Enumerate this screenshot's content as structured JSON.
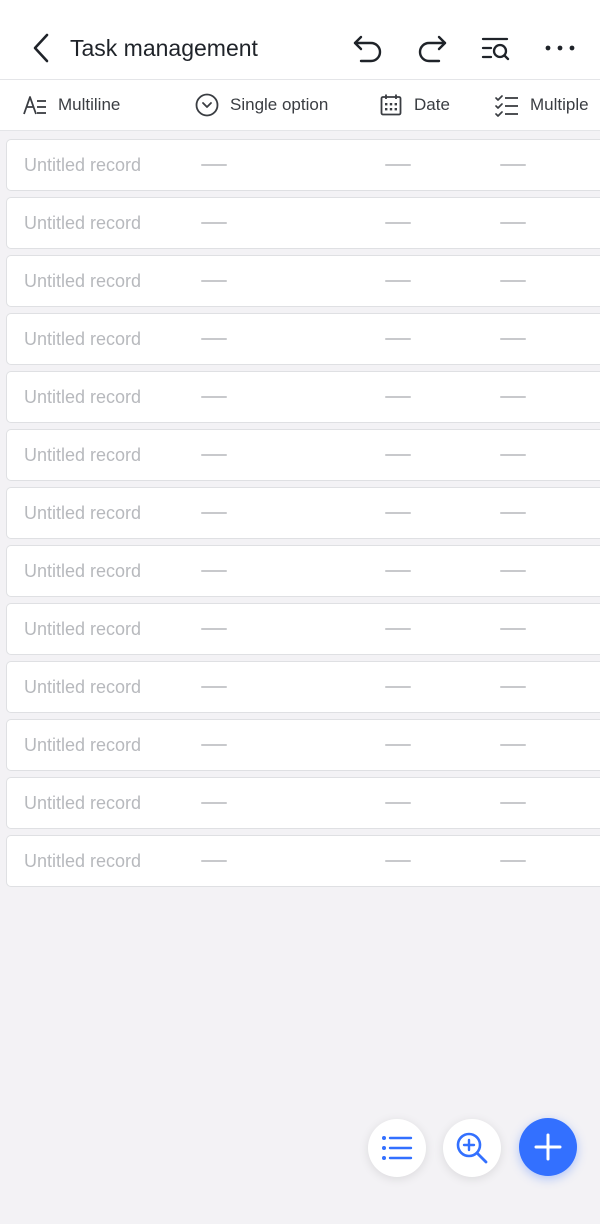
{
  "header": {
    "title": "Task management"
  },
  "fields": [
    {
      "label": "Multiline",
      "icon": "multiline-text-icon"
    },
    {
      "label": "Single option",
      "icon": "single-option-icon"
    },
    {
      "label": "Date",
      "icon": "calendar-icon"
    },
    {
      "label": "Multiple",
      "icon": "multiple-option-icon"
    }
  ],
  "records": [
    {
      "title": "Untitled record"
    },
    {
      "title": "Untitled record"
    },
    {
      "title": "Untitled record"
    },
    {
      "title": "Untitled record"
    },
    {
      "title": "Untitled record"
    },
    {
      "title": "Untitled record"
    },
    {
      "title": "Untitled record"
    },
    {
      "title": "Untitled record"
    },
    {
      "title": "Untitled record"
    },
    {
      "title": "Untitled record"
    },
    {
      "title": "Untitled record"
    },
    {
      "title": "Untitled record"
    },
    {
      "title": "Untitled record"
    }
  ],
  "colors": {
    "primary": "#3370ff",
    "placeholder_text": "#b7b9bd",
    "background": "#f3f2f5"
  }
}
